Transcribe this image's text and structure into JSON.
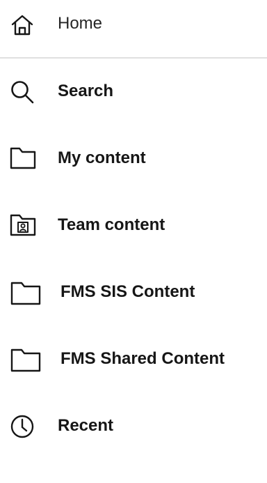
{
  "nav": {
    "items": [
      {
        "label": "Home",
        "icon": "home-icon"
      },
      {
        "label": "Search",
        "icon": "search-icon"
      },
      {
        "label": "My content",
        "icon": "folder-icon"
      },
      {
        "label": "Team content",
        "icon": "team-folder-icon"
      },
      {
        "label": "FMS SIS Content",
        "icon": "folder-icon"
      },
      {
        "label": "FMS Shared Content",
        "icon": "folder-icon"
      },
      {
        "label": "Recent",
        "icon": "clock-icon"
      }
    ]
  },
  "colors": {
    "text": "#161616",
    "divider": "#e0e0e0",
    "icon": "#161616"
  }
}
